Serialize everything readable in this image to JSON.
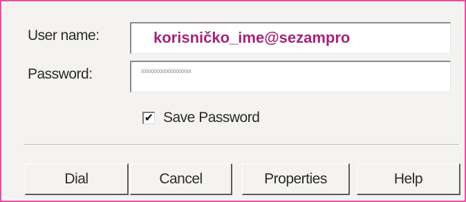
{
  "form": {
    "username_label": "User name:",
    "username_value": "korisničko_ime@sezampro",
    "password_label": "Password:",
    "password_value": "xxxxxxxxxxxxxxxxxx",
    "save_password_label": "Save Password",
    "save_password_checked": true,
    "checkmark_glyph": "✔"
  },
  "buttons": {
    "dial": "Dial",
    "cancel": "Cancel",
    "properties": "Properties",
    "help": "Help"
  },
  "colors": {
    "accent_border": "#e94fa4",
    "username_text": "#a4237a",
    "dialog_background": "#f4f3f1"
  }
}
